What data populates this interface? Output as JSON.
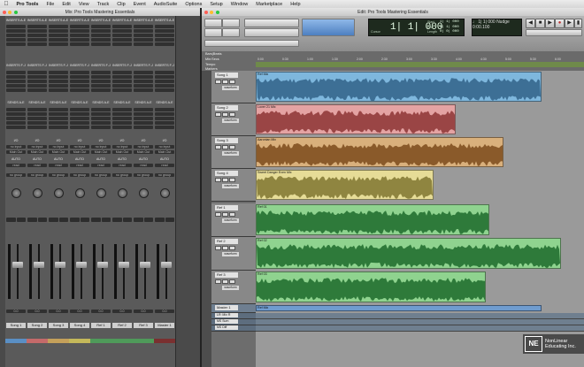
{
  "menubar": {
    "apple": "",
    "items": [
      "Pro Tools",
      "File",
      "Edit",
      "View",
      "Track",
      "Clip",
      "Event",
      "AudioSuite",
      "Options",
      "Setup",
      "Window",
      "Marketplace",
      "Help"
    ]
  },
  "mix_window": {
    "title": "Mix: Pro Tools Mastering Essentials"
  },
  "edit_window": {
    "title": "Edit: Pro Tools Mastering Essentials"
  },
  "strips": [
    {
      "name": "Song 1",
      "color": "#5a8fc4",
      "vol": "0.0"
    },
    {
      "name": "Song 2",
      "color": "#c46a6a",
      "vol": "0.0"
    },
    {
      "name": "Song 3",
      "color": "#c4a05a",
      "vol": "0.0"
    },
    {
      "name": "Song 4",
      "color": "#c4b85a",
      "vol": "0.0"
    },
    {
      "name": "Ref 1",
      "color": "#4f9a5a",
      "vol": "0.0"
    },
    {
      "name": "Ref 2",
      "color": "#4f9a5a",
      "vol": "0.0"
    },
    {
      "name": "Ref 3",
      "color": "#4f9a5a",
      "vol": "0.0"
    },
    {
      "name": "Master 1",
      "color": "#7a3030",
      "vol": "0.0"
    }
  ],
  "strip_labels": {
    "inserts_ae": "INSERTS A-E",
    "inserts_fj": "INSERTS F-J",
    "sends_ae": "SENDS A-E",
    "io": "I/O",
    "input": "no input",
    "output": "Main Out",
    "auto": "AUTO",
    "auto_mode": "read",
    "group": "no group"
  },
  "counter": {
    "main": "1| 1| 000",
    "start_label": "Start",
    "start_value": "1| 1| 000",
    "end_label": "End",
    "end_value": "1| 1| 000",
    "length_label": "Length",
    "length_value": "0| 0| 000",
    "cursor_label": "Cursor",
    "cursor_value": "1| 1| 000",
    "nudge_label": "Nudge",
    "nudge_value": "0:00.100"
  },
  "rulers": [
    "Bars|Beats",
    "Min:Secs",
    "Tempo",
    "Markers"
  ],
  "ruler_ticks": [
    "0:00",
    "0:30",
    "1:00",
    "1:30",
    "2:00",
    "2:30",
    "3:00",
    "3:30",
    "4:00",
    "4:30",
    "5:00",
    "5:30",
    "6:00"
  ],
  "tempo": "120",
  "tracks": [
    {
      "name": "Song 1",
      "clip": "Ref Mix",
      "color": "#7eb7dd",
      "wave": "#3d6f95"
    },
    {
      "name": "Song 2",
      "clip": "Lover 21 Mix",
      "color": "#e4a3a3",
      "wave": "#9a4545"
    },
    {
      "name": "Song 3",
      "clip": "Aaronian Mix",
      "color": "#d9b07c",
      "wave": "#8a5a2a"
    },
    {
      "name": "Song 4",
      "clip": "Sweet Danger Even Mix",
      "color": "#e6dc97",
      "wave": "#8f8540"
    },
    {
      "name": "Ref 1",
      "clip": "Ref 01",
      "color": "#8fd38f",
      "wave": "#2e7a3a"
    },
    {
      "name": "Ref 2",
      "clip": "Ref 02",
      "color": "#8fd38f",
      "wave": "#2e7a3a"
    },
    {
      "name": "Ref 3",
      "clip": "Ref 03",
      "color": "#8fd38f",
      "wave": "#2e7a3a"
    },
    {
      "name": "Master 1",
      "clip": "Ref Mix",
      "color": "#6f9ccf",
      "wave": "#2e5a8a"
    }
  ],
  "track_controls": {
    "waveform": "waveform",
    "dyn": "dyn"
  },
  "aux_tracks": [
    "LR: Mix R",
    "MS Sum",
    "MS Diff"
  ],
  "logo": {
    "mark": "NE",
    "line1": "NonLinear",
    "line2": "Educating Inc."
  }
}
